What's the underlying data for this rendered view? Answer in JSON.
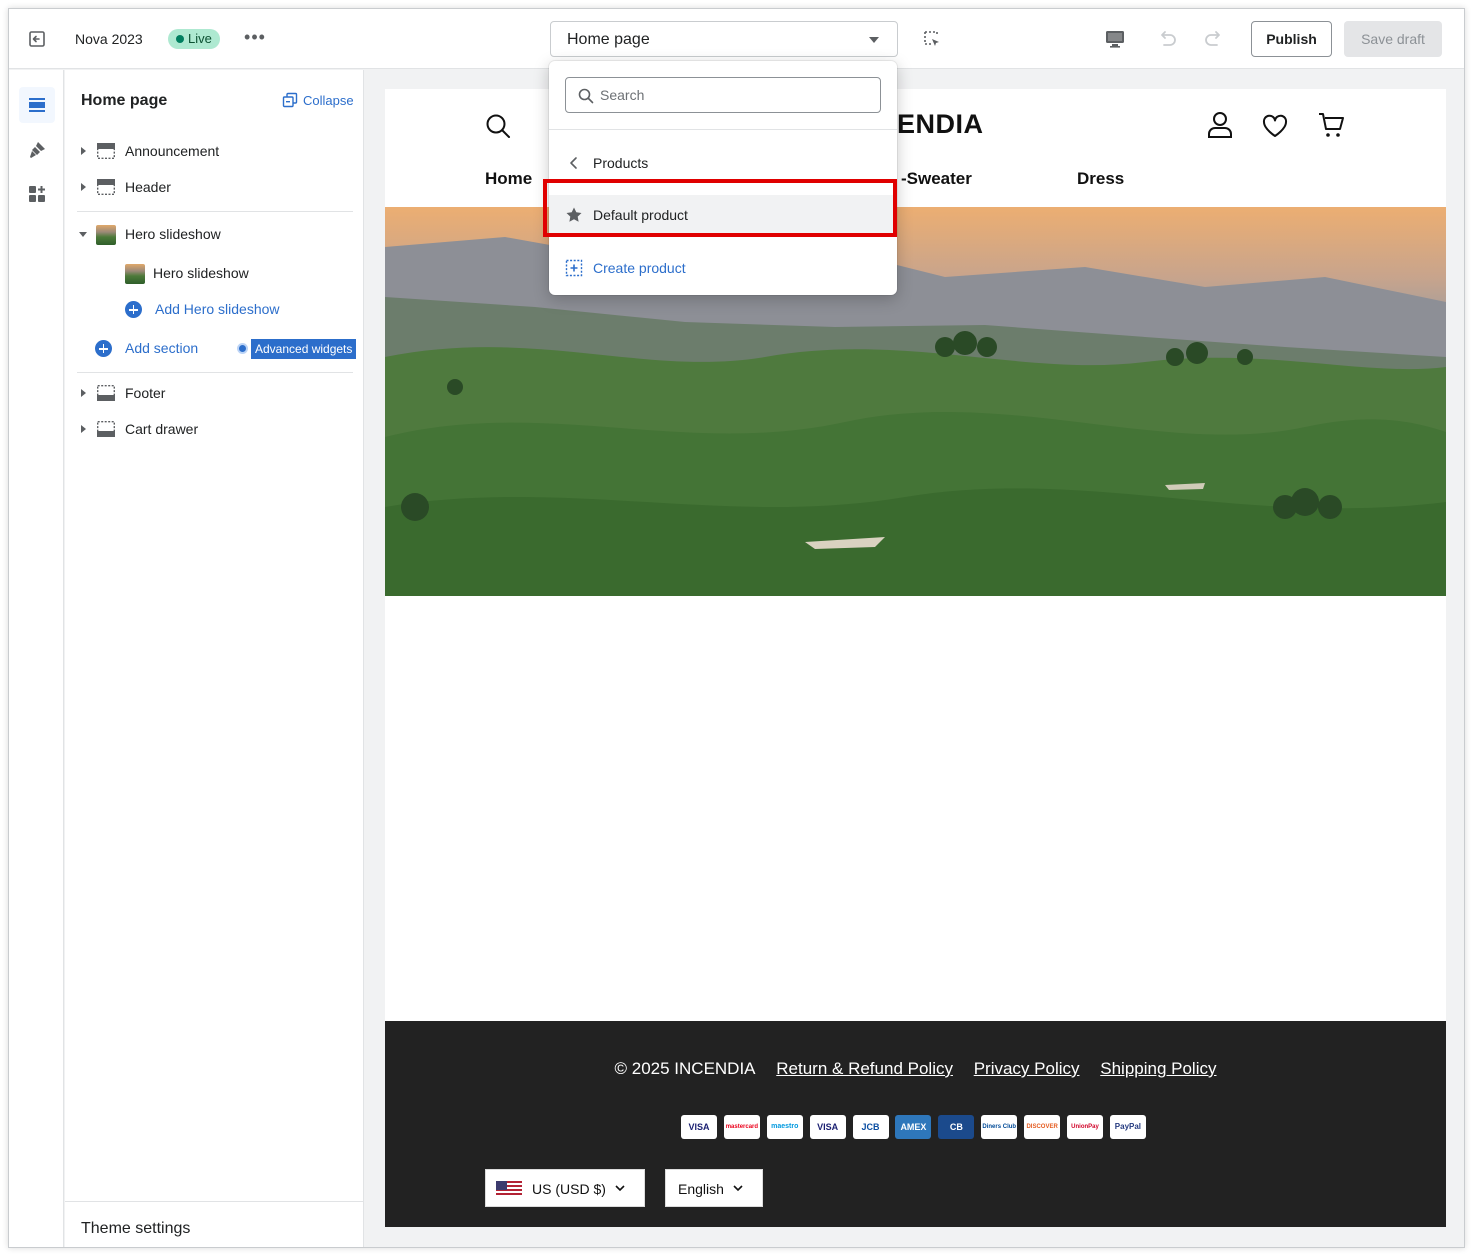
{
  "topbar": {
    "store_name": "Nova 2023",
    "live_label": "Live",
    "more_label": "•••",
    "page_selector": "Home page",
    "publish_label": "Publish",
    "save_draft_label": "Save draft"
  },
  "sidebar": {
    "title": "Home page",
    "collapse_label": "Collapse",
    "sections": {
      "announcement": "Announcement",
      "header": "Header",
      "hero": "Hero slideshow",
      "hero_block": "Hero slideshow",
      "add_hero": "Add Hero slideshow",
      "add_section": "Add section",
      "advanced_widgets": "Advanced widgets",
      "footer": "Footer",
      "cart_drawer": "Cart drawer"
    },
    "theme_settings": "Theme settings"
  },
  "preview": {
    "logo": "ENDIA",
    "nav": [
      "Home",
      "-Sweater",
      "Dress"
    ],
    "footer": {
      "copyright": "© 2025 INCENDIA",
      "links": [
        "Return & Refund Policy",
        "Privacy Policy",
        "Shipping Policy"
      ],
      "payments": [
        "VISA",
        "mastercard",
        "maestro",
        "VISA",
        "JCB",
        "AMEX",
        "CB",
        "Diners Club",
        "DISCOVER",
        "UnionPay",
        "PayPal"
      ],
      "currency": "US  (USD $)",
      "language": "English"
    }
  },
  "dropdown": {
    "search_placeholder": "Search",
    "back_label": "Products",
    "selected_item": "Default product",
    "create_label": "Create product"
  },
  "colors": {
    "accent": "#2c6ecb",
    "live_badge": "#aee9d1",
    "highlight": "#e00000",
    "footer_bg": "#222222"
  }
}
